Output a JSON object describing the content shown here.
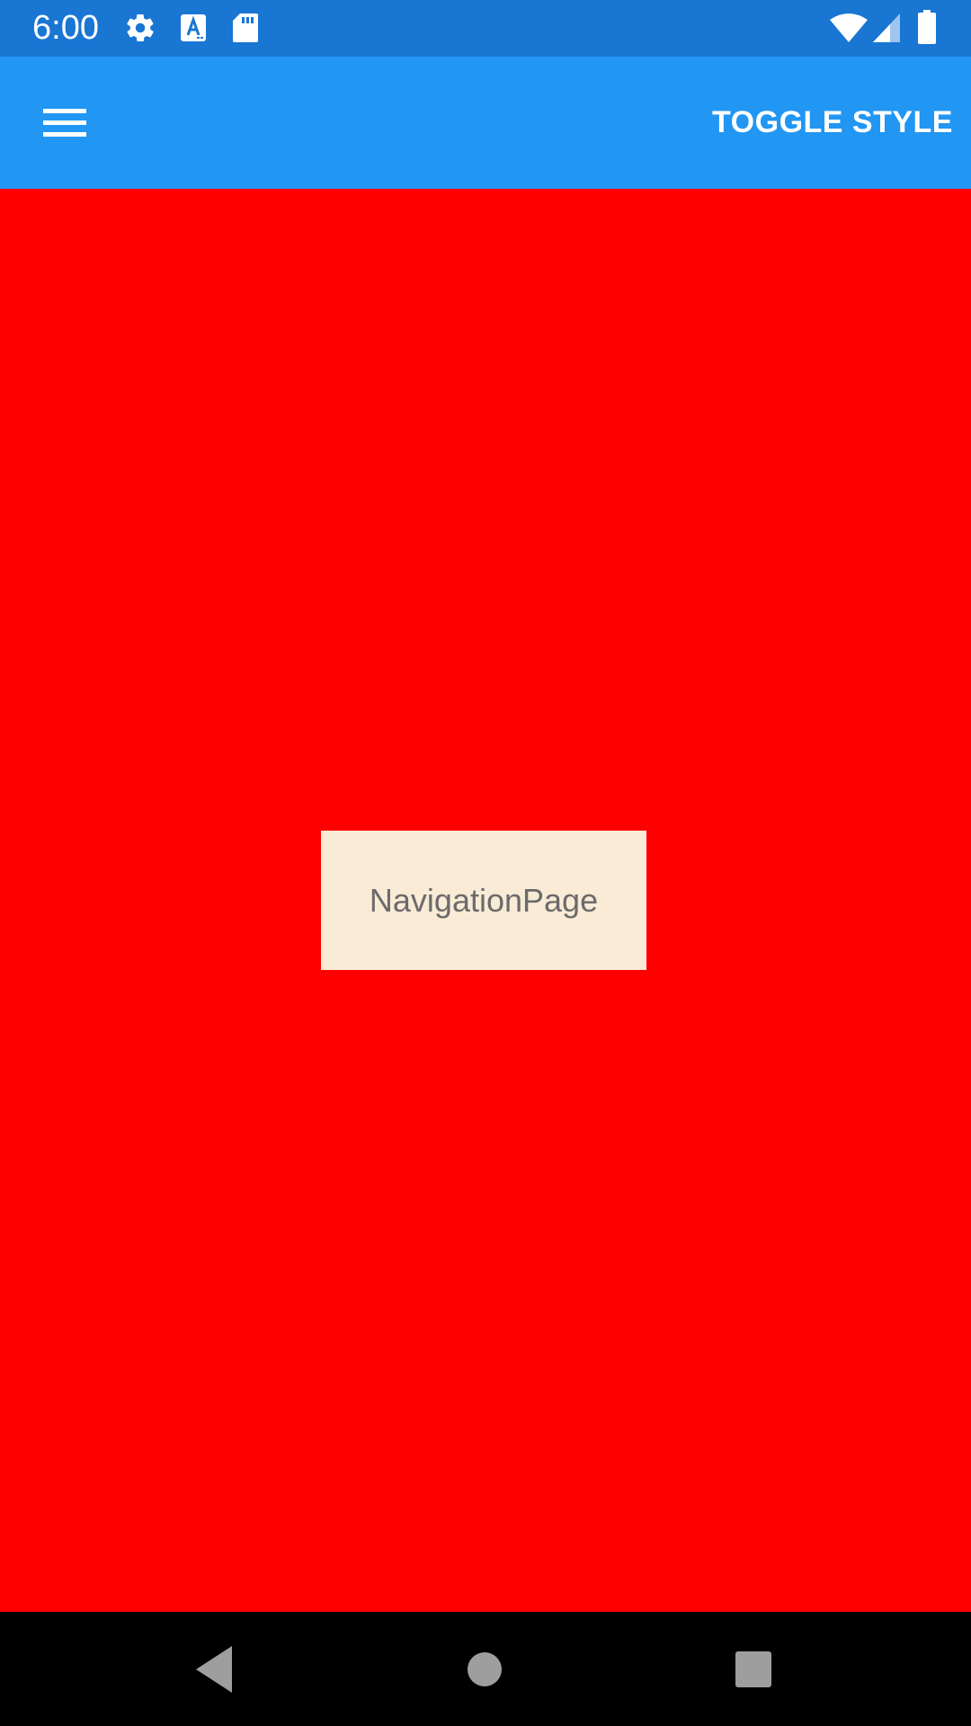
{
  "status_bar": {
    "time": "6:00",
    "background": "#1976D2",
    "left_icons": [
      "gear-icon",
      "font-a-icon",
      "sd-card-icon"
    ],
    "right_icons": [
      "wifi-icon",
      "cell-signal-icon",
      "battery-icon"
    ]
  },
  "app_bar": {
    "background": "#2196F3",
    "menu_icon": "hamburger-menu-icon",
    "toggle_label": "TOGGLE STYLE"
  },
  "content": {
    "background": "#FF0000",
    "label": "NavigationPage",
    "label_background": "#FAEBD7"
  },
  "nav_bar": {
    "buttons": [
      "back-triangle-icon",
      "home-circle-icon",
      "recents-square-icon"
    ]
  }
}
